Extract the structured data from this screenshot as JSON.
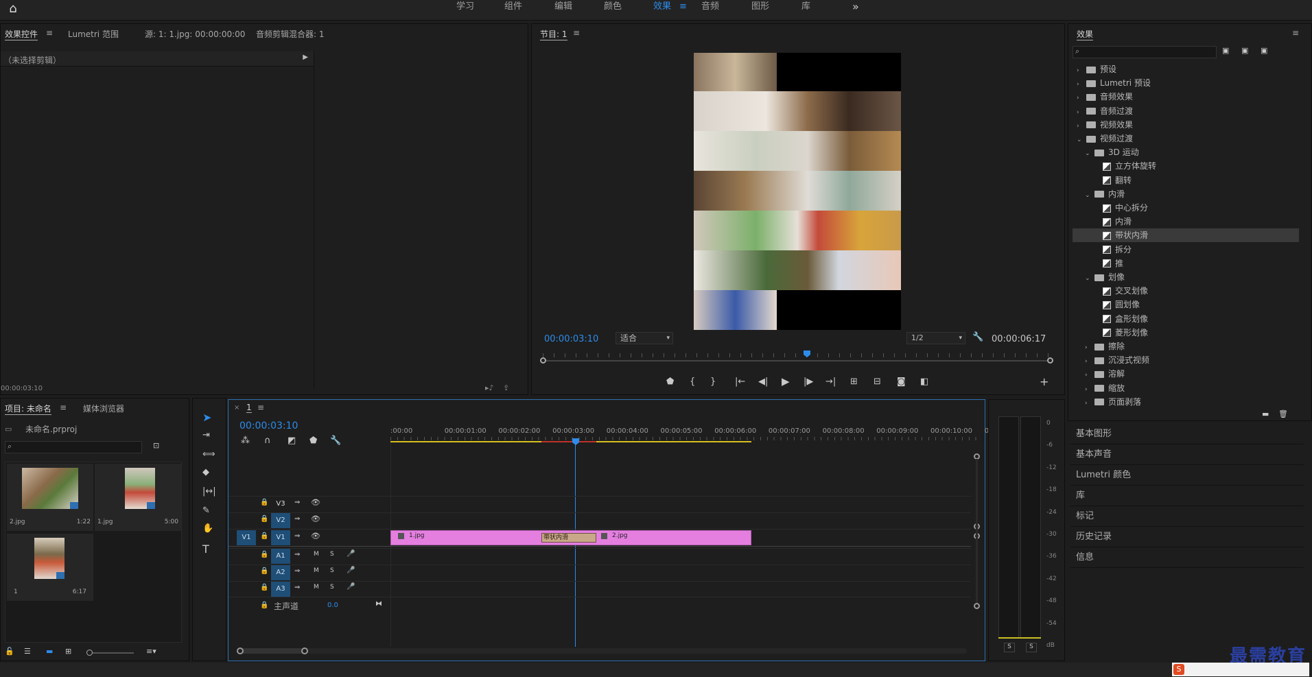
{
  "topbar": {
    "workspaces": [
      "学习",
      "组件",
      "编辑",
      "颜色",
      "效果",
      "音频",
      "图形",
      "库"
    ],
    "active": "效果",
    "more": "»"
  },
  "effect_controls": {
    "tabs": [
      "效果控件",
      "Lumetri 范围",
      "源: 1: 1.jpg: 00:00:00:00",
      "音频剪辑混合器: 1"
    ],
    "no_clip": "（未选择剪辑）",
    "timecode": "00:00:03:10"
  },
  "program": {
    "title": "节目: 1",
    "timecode": "00:00:03:10",
    "fit": "适合",
    "resolution": "1/2",
    "duration": "00:00:06:17"
  },
  "project": {
    "tabs": [
      "项目: 未命名",
      "媒体浏览器"
    ],
    "file": "未命名.prproj",
    "items": [
      {
        "name": "2.jpg",
        "dur": "1:22"
      },
      {
        "name": "1.jpg",
        "dur": "5:00"
      },
      {
        "name": "1",
        "dur": "6:17"
      }
    ]
  },
  "timeline": {
    "tab": "1",
    "timecode": "00:00:03:10",
    "ruler": [
      ":00:00",
      "00:00:01:00",
      "00:00:02:00",
      "00:00:03:00",
      "00:00:04:00",
      "00:00:05:00",
      "00:00:06:00",
      "00:00:07:00",
      "00:00:08:00",
      "00:00:09:00",
      "00:00:10:00",
      "0"
    ],
    "video_tracks": [
      "V3",
      "V2",
      "V1"
    ],
    "audio_tracks": [
      "A1",
      "A2",
      "A3"
    ],
    "master": "主声道",
    "master_val": "0.0",
    "src_v": "V1",
    "clip1": "1.jpg",
    "clip2": "2.jpg",
    "transition": "带状内滑",
    "m": "M",
    "s": "S"
  },
  "vu": {
    "labels": [
      "0",
      "-6",
      "-12",
      "-18",
      "-24",
      "-30",
      "-36",
      "-42",
      "-48",
      "-54",
      "dB"
    ],
    "solo": "S"
  },
  "effects": {
    "title": "效果",
    "tree": [
      {
        "label": "预设",
        "level": 0,
        "type": "folder",
        "exp": false
      },
      {
        "label": "Lumetri 预设",
        "level": 0,
        "type": "folder",
        "exp": false
      },
      {
        "label": "音频效果",
        "level": 0,
        "type": "folder",
        "exp": false
      },
      {
        "label": "音频过渡",
        "level": 0,
        "type": "folder",
        "exp": false
      },
      {
        "label": "视频效果",
        "level": 0,
        "type": "folder",
        "exp": false
      },
      {
        "label": "视频过渡",
        "level": 0,
        "type": "folder",
        "exp": true
      },
      {
        "label": "3D 运动",
        "level": 1,
        "type": "folder",
        "exp": true
      },
      {
        "label": "立方体旋转",
        "level": 2,
        "type": "preset"
      },
      {
        "label": "翻转",
        "level": 2,
        "type": "preset"
      },
      {
        "label": "内滑",
        "level": 1,
        "type": "folder",
        "exp": true
      },
      {
        "label": "中心拆分",
        "level": 2,
        "type": "preset"
      },
      {
        "label": "内滑",
        "level": 2,
        "type": "preset"
      },
      {
        "label": "带状内滑",
        "level": 2,
        "type": "preset",
        "sel": true
      },
      {
        "label": "拆分",
        "level": 2,
        "type": "preset"
      },
      {
        "label": "推",
        "level": 2,
        "type": "preset"
      },
      {
        "label": "划像",
        "level": 1,
        "type": "folder",
        "exp": true
      },
      {
        "label": "交叉划像",
        "level": 2,
        "type": "preset"
      },
      {
        "label": "圆划像",
        "level": 2,
        "type": "preset"
      },
      {
        "label": "盒形划像",
        "level": 2,
        "type": "preset"
      },
      {
        "label": "菱形划像",
        "level": 2,
        "type": "preset"
      },
      {
        "label": "擦除",
        "level": 1,
        "type": "folder",
        "exp": false
      },
      {
        "label": "沉浸式视频",
        "level": 1,
        "type": "folder",
        "exp": false
      },
      {
        "label": "溶解",
        "level": 1,
        "type": "folder",
        "exp": false
      },
      {
        "label": "缩放",
        "level": 1,
        "type": "folder",
        "exp": false
      },
      {
        "label": "页面剥落",
        "level": 1,
        "type": "folder",
        "exp": false
      }
    ],
    "panels": [
      "基本图形",
      "基本声音",
      "Lumetri 颜色",
      "库",
      "标记",
      "历史记录",
      "信息"
    ]
  },
  "watermark": "最需教育"
}
